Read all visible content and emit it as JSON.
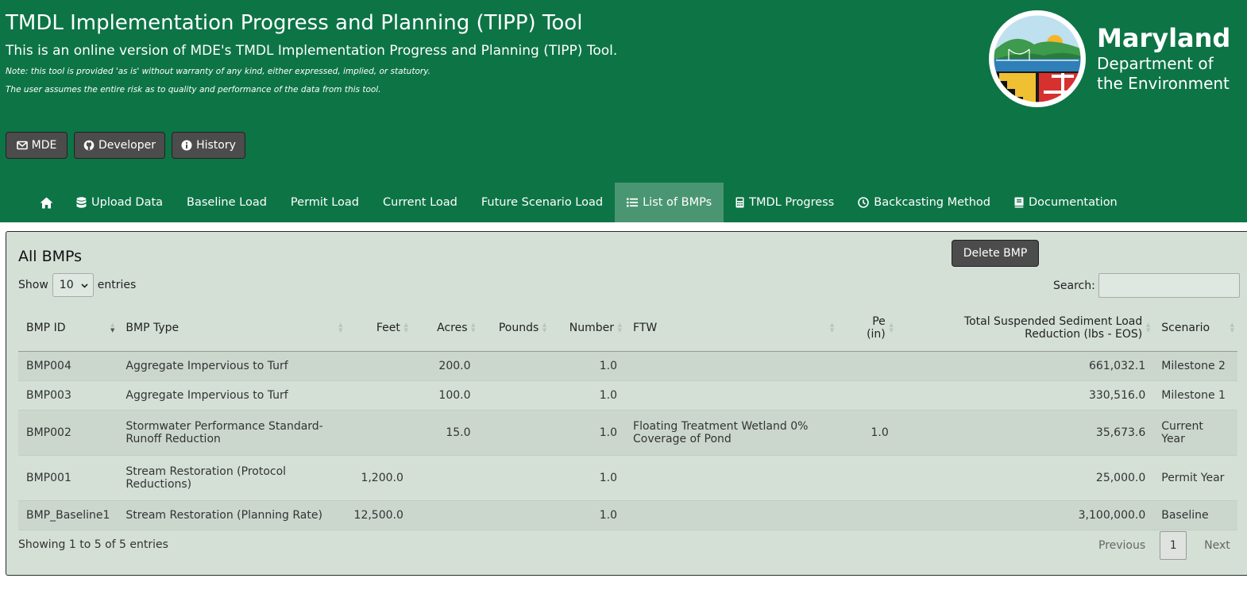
{
  "header": {
    "title": "TMDL Implementation Progress and Planning (TIPP) Tool",
    "subtitle": "This is an online version of MDE's TMDL Implementation Progress and Planning (TIPP) Tool.",
    "note1": "Note: this tool is provided 'as is' without warranty of any kind, either expressed, implied, or statutory.",
    "note2": "The user assumes the entire risk as to quality and performance of the data from this tool.",
    "buttons": [
      {
        "label": "MDE",
        "icon": "envelope-icon"
      },
      {
        "label": "Developer",
        "icon": "github-icon"
      },
      {
        "label": "History",
        "icon": "info-circle-icon"
      }
    ],
    "brand": {
      "line1": "Maryland",
      "line2": "Department of",
      "line3": "the Environment"
    }
  },
  "nav": {
    "home_icon": "home-icon",
    "items": [
      {
        "label": "Upload Data",
        "icon": "database-icon"
      },
      {
        "label": "Baseline Load"
      },
      {
        "label": "Permit Load"
      },
      {
        "label": "Current Load"
      },
      {
        "label": "Future Scenario Load"
      },
      {
        "label": "List of BMPs",
        "icon": "list-icon",
        "active": true
      },
      {
        "label": "TMDL Progress",
        "icon": "calculator-icon"
      },
      {
        "label": "Backcasting Method",
        "icon": "clock-icon"
      },
      {
        "label": "Documentation",
        "icon": "book-icon"
      }
    ]
  },
  "panel": {
    "title": "All BMPs",
    "delete_label": "Delete BMP",
    "show_label": "Show",
    "entries_value": "10",
    "entries_label": "entries",
    "search_label": "Search:",
    "search_value": ""
  },
  "table": {
    "headers": {
      "bmp_id": "BMP ID",
      "bmp_type": "BMP Type",
      "feet": "Feet",
      "acres": "Acres",
      "pounds": "Pounds",
      "number": "Number",
      "ftw": "FTW",
      "pe_line1": "Pe",
      "pe_line2": "(in)",
      "tss_line1": "Total Suspended Sediment Load",
      "tss_line2": "Reduction (lbs - EOS)",
      "scenario": "Scenario"
    },
    "rows": [
      {
        "id": "BMP004",
        "type_line1": "Aggregate Impervious to Turf",
        "type_line2": "",
        "feet": "",
        "acres": "200.0",
        "pounds": "",
        "number": "1.0",
        "ftw_line1": "",
        "ftw_line2": "",
        "pe": "",
        "tss": "661,032.1",
        "scenario_line1": "Milestone 2",
        "scenario_line2": ""
      },
      {
        "id": "BMP003",
        "type_line1": "Aggregate Impervious to Turf",
        "type_line2": "",
        "feet": "",
        "acres": "100.0",
        "pounds": "",
        "number": "1.0",
        "ftw_line1": "",
        "ftw_line2": "",
        "pe": "",
        "tss": "330,516.0",
        "scenario_line1": "Milestone 1",
        "scenario_line2": ""
      },
      {
        "id": "BMP002",
        "type_line1": "Stormwater Performance Standard-",
        "type_line2": "Runoff Reduction",
        "feet": "",
        "acres": "15.0",
        "pounds": "",
        "number": "1.0",
        "ftw_line1": "Floating Treatment Wetland 0%",
        "ftw_line2": "Coverage of Pond",
        "pe": "1.0",
        "tss": "35,673.6",
        "scenario_line1": "Current",
        "scenario_line2": "Year"
      },
      {
        "id": "BMP001",
        "type_line1": "Stream Restoration (Protocol",
        "type_line2": "Reductions)",
        "feet": "1,200.0",
        "acres": "",
        "pounds": "",
        "number": "1.0",
        "ftw_line1": "",
        "ftw_line2": "",
        "pe": "",
        "tss": "25,000.0",
        "scenario_line1": "Permit Year",
        "scenario_line2": ""
      },
      {
        "id": "BMP_Baseline1",
        "type_line1": "Stream Restoration (Planning Rate)",
        "type_line2": "",
        "feet": "12,500.0",
        "acres": "",
        "pounds": "",
        "number": "1.0",
        "ftw_line1": "",
        "ftw_line2": "",
        "pe": "",
        "tss": "3,100,000.0",
        "scenario_line1": "Baseline",
        "scenario_line2": ""
      }
    ]
  },
  "footer": {
    "info": "Showing 1 to 5 of 5 entries",
    "previous": "Previous",
    "page": "1",
    "next": "Next"
  },
  "colors": {
    "header_green": "#0d7446",
    "active_tab": "#4a9672",
    "panel_bg": "#d4e0d6",
    "button_dark": "#4c4c4c"
  }
}
